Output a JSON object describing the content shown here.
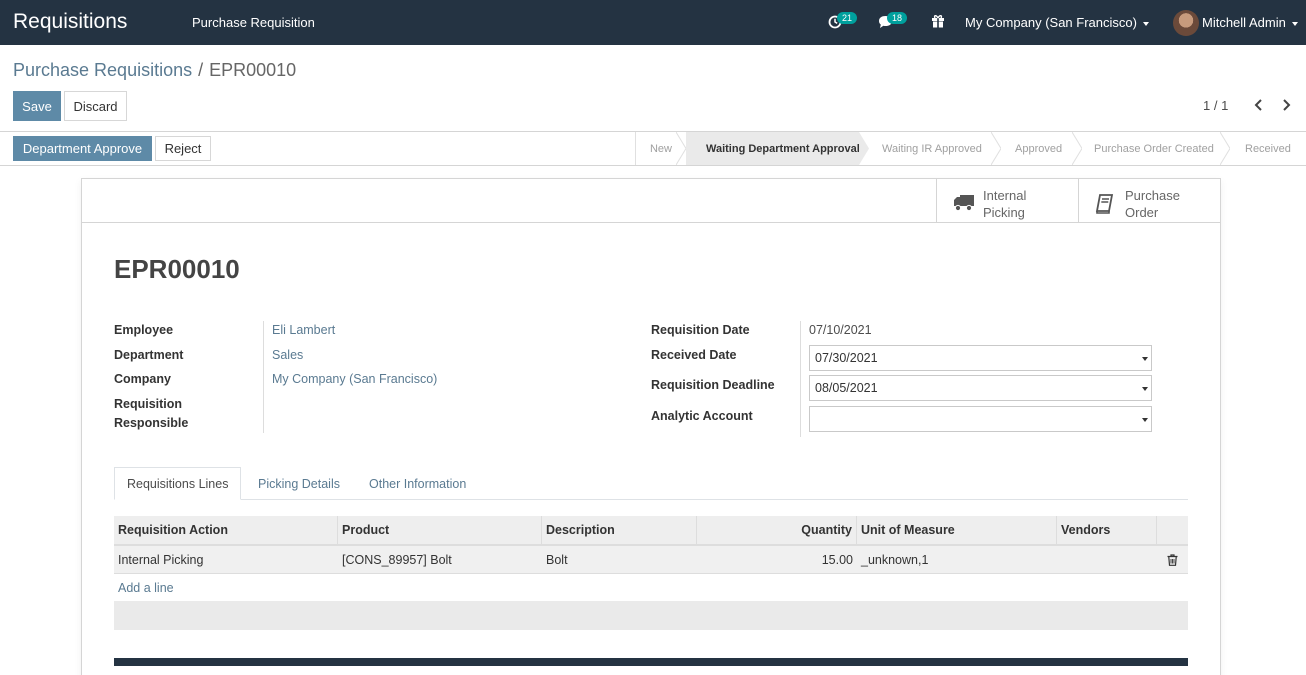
{
  "navbar": {
    "app_title": "Requisitions",
    "menu_item": "Purchase Requisition",
    "activity_count": "21",
    "messages_count": "18",
    "company": "My Company (San Francisco)",
    "user": "Mitchell Admin",
    "icons": [
      "clock-icon",
      "chat-icon",
      "gift-icon"
    ]
  },
  "breadcrumb": {
    "parent": "Purchase Requisitions",
    "separator": "/",
    "current": "EPR00010"
  },
  "controls": {
    "save_label": "Save",
    "discard_label": "Discard",
    "pager": "1 / 1"
  },
  "statusbar": {
    "approve_label": "Department Approve",
    "reject_label": "Reject",
    "stages": [
      "New",
      "Waiting Department Approval",
      "Waiting IR Approved",
      "Approved",
      "Purchase Order Created",
      "Received"
    ],
    "active_stage": "Waiting Department Approval"
  },
  "smart_buttons": {
    "internal_picking_l1": "Internal",
    "internal_picking_l2": "Picking",
    "purchase_order_l1": "Purchase",
    "purchase_order_l2": "Order"
  },
  "record": {
    "name": "EPR00010",
    "labels": {
      "employee": "Employee",
      "department": "Department",
      "company": "Company",
      "responsible_l1": "Requisition",
      "responsible_l2": "Responsible",
      "requisition_date": "Requisition Date",
      "received_date": "Received Date",
      "deadline": "Requisition Deadline",
      "analytic": "Analytic Account"
    },
    "values": {
      "employee": "Eli Lambert",
      "department": "Sales",
      "company": "My Company (San Francisco)",
      "responsible": "",
      "requisition_date": "07/10/2021",
      "received_date": "07/30/2021",
      "deadline": "08/05/2021",
      "analytic": ""
    }
  },
  "tabs": [
    "Requisitions Lines",
    "Picking Details",
    "Other Information"
  ],
  "lines": {
    "headers": [
      "Requisition Action",
      "Product",
      "Description",
      "Quantity",
      "Unit of Measure",
      "Vendors"
    ],
    "rows": [
      [
        "Internal Picking",
        "[CONS_89957] Bolt",
        "Bolt",
        "15.00",
        "_unknown,1",
        ""
      ]
    ],
    "add_line": "Add a line"
  },
  "colors": {
    "navbar": "#243342",
    "primary": "#5e8aa7",
    "link": "#5a7a91",
    "badge": "#00a09d"
  }
}
